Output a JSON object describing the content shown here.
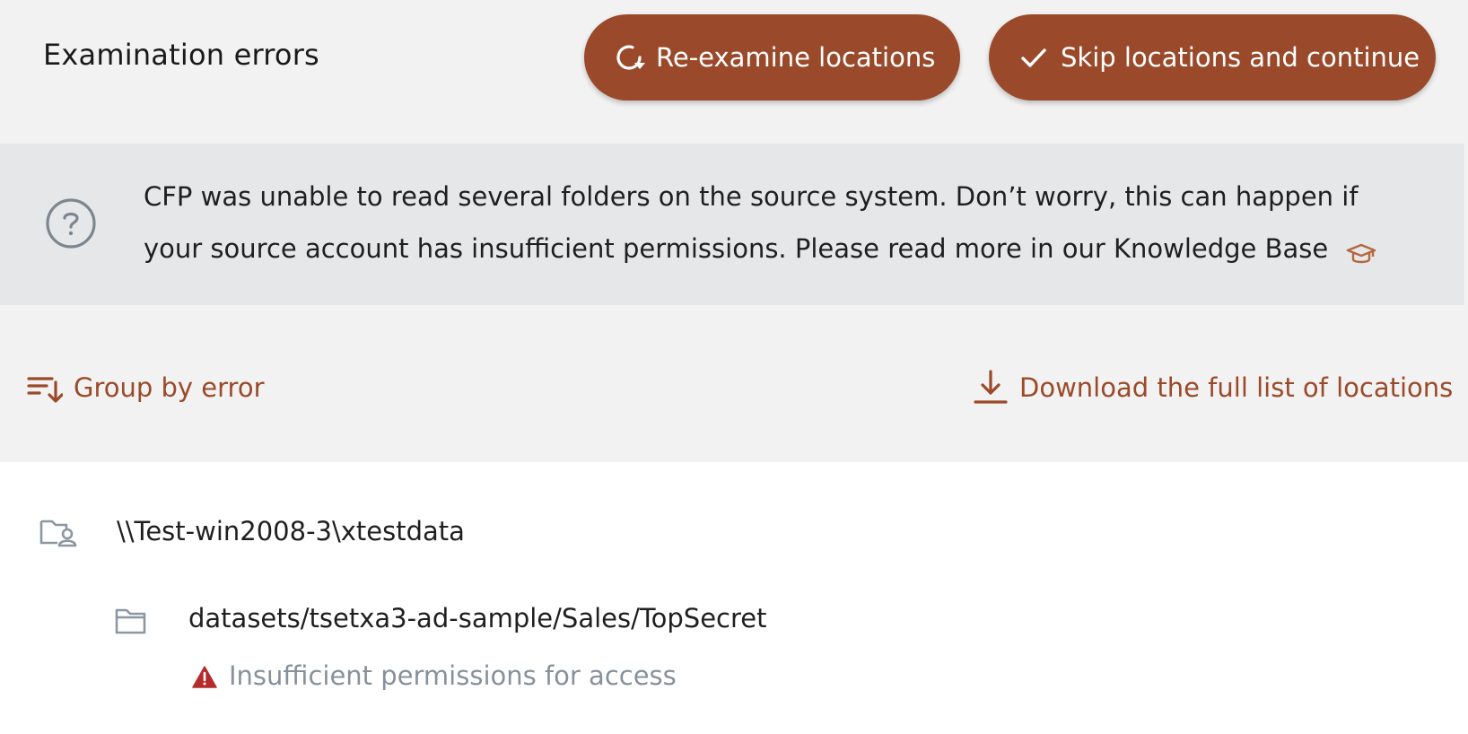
{
  "header": {
    "title": "Examination errors",
    "reexamine_label": "Re-examine locations",
    "skip_label": "Skip locations and continue"
  },
  "info": {
    "message": "CFP was unable to read several folders on the source system. Don’t worry, this can happen if your source account has insufficient permissions. Please read more in our Knowledge Base",
    "icon": "question-circle-icon",
    "link_icon": "graduation-cap-icon"
  },
  "actions": {
    "group_label": "Group by error",
    "download_label": "Download the full list of locations"
  },
  "locations": {
    "share": {
      "name": "\\\\Test-win2008-3\\xtestdata",
      "icon": "shared-folder-icon"
    },
    "folder": {
      "path": "datasets/tsetxa3-ad-sample/Sales/TopSecret",
      "icon": "folder-icon"
    },
    "error": {
      "message": "Insufficient permissions for access",
      "icon": "warning-icon"
    }
  },
  "colors": {
    "accent": "#9a4a2a",
    "banner_bg": "#e6e7e9",
    "page_bg": "#f2f2f2",
    "muted_text": "#87919b",
    "error_red": "#b52a2a"
  }
}
